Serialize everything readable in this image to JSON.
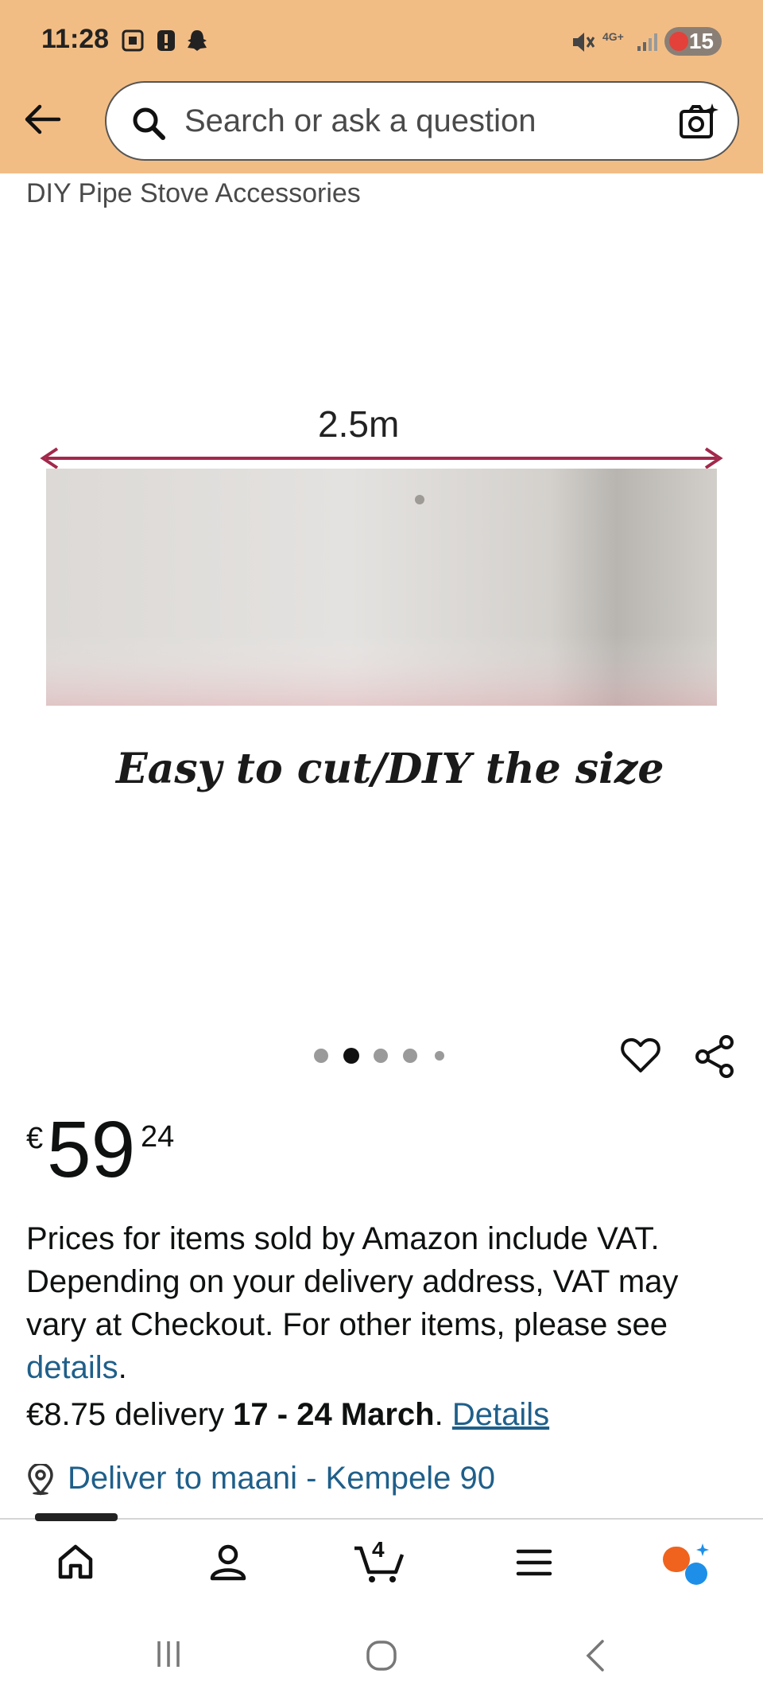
{
  "status_bar": {
    "time": "11:28",
    "network": "4G+",
    "battery": "15"
  },
  "search": {
    "placeholder": "Search or ask a question"
  },
  "product": {
    "title": "DIY Pipe Stove Accessories",
    "image_dimension": "2.5m",
    "image_caption": "Easy to cut/DIY the size",
    "carousel_pages": 5,
    "carousel_active": 2
  },
  "price": {
    "currency": "€",
    "whole": "59",
    "fraction": "24"
  },
  "vat": {
    "text": "Prices for items sold by Amazon include VAT. Depending on your delivery address, VAT may vary at Checkout. For other items, please see ",
    "link": "details",
    "end": "."
  },
  "delivery": {
    "cost": "€8.75 delivery ",
    "dates": "17 - 24 March",
    "sep": ". ",
    "details": "Details"
  },
  "deliver_to": "Deliver to maani - Kempele 90",
  "bottom_nav": {
    "cart_count": "4"
  },
  "colors": {
    "header": "#f2bd85",
    "link": "#1f5f8a",
    "arrow": "#a3284b",
    "ai_orange": "#f0631e",
    "ai_blue": "#1d8fe8"
  }
}
